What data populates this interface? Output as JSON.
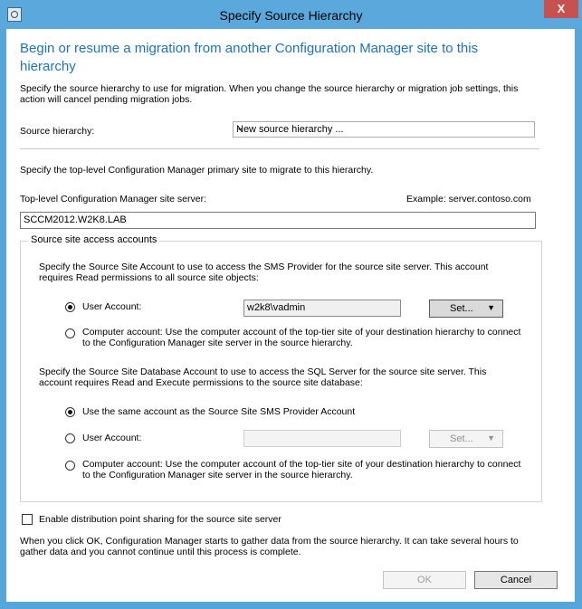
{
  "window": {
    "title": "Specify Source Hierarchy",
    "close_label": "X"
  },
  "content": {
    "heading": "Begin or resume a migration from another Configuration Manager site to this hierarchy",
    "intro": "Specify the source hierarchy to use for migration. When you change the source hierarchy or migration job settings, this action will cancel pending migration jobs.",
    "source_hierarchy_label": "Source hierarchy:",
    "source_hierarchy_value": "New source hierarchy ...",
    "top_level_intro": "Specify the top-level Configuration Manager primary site to migrate to this hierarchy.",
    "server_label": "Top-level Configuration Manager site server:",
    "example": "Example: server.contoso.com",
    "server_value": "SCCM2012.W2K8.LAB"
  },
  "accounts": {
    "group_title": "Source site access accounts",
    "sms_intro": "Specify the Source Site Account to use to access the SMS Provider for the source site server. This account requires Read permissions to all source site objects:",
    "sms_user_label": "User Account:",
    "sms_user_value": "w2k8\\vadmin",
    "set_label": "Set...",
    "computer_account_text": "Computer account: Use the computer account of the top-tier site of your destination hierarchy to connect to the Configuration Manager site server in the source hierarchy.",
    "db_intro": "Specify the Source Site Database Account to use to access the SQL Server for the source site server. This account requires Read and Execute permissions to the source site database:",
    "same_account_label": "Use the same account as the Source Site SMS Provider Account",
    "db_user_label": "User Account:",
    "db_set_label": "Set...",
    "db_computer_account_text": "Computer account: Use the computer account of the top-tier site of your destination hierarchy to connect to the Configuration Manager site server in the source hierarchy."
  },
  "footer": {
    "distribution_label": "Enable distribution point sharing for the source site server",
    "ok_note": "When you click OK, Configuration Manager starts to gather data from the source hierarchy. It can take several hours to gather data and you cannot continue until this process is complete.",
    "ok_label": "OK",
    "cancel_label": "Cancel"
  }
}
